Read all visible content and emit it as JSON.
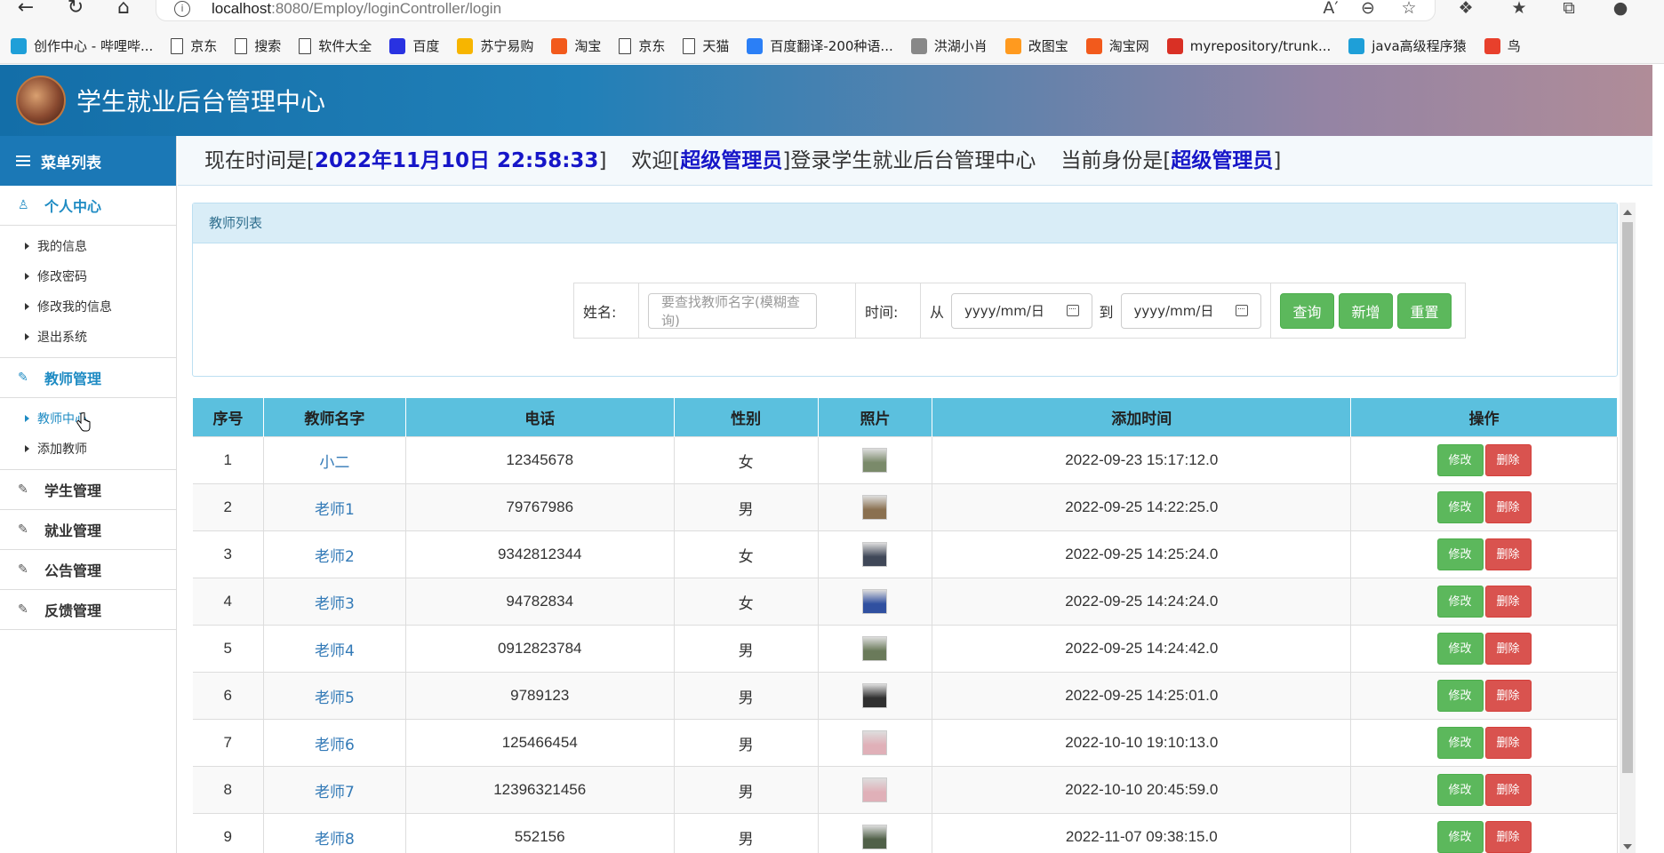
{
  "browser": {
    "url_host": "localhost",
    "url_rest": ":8080/Employ/loginController/login",
    "bookmarks": [
      {
        "label": "创作中心 - 哔哩哔...",
        "icon": "bilibili-icon",
        "color": "#1e9fd8"
      },
      {
        "label": "京东",
        "icon": "page-icon",
        "color": "#ffffff"
      },
      {
        "label": "搜索",
        "icon": "page-icon",
        "color": "#ffffff"
      },
      {
        "label": "软件大全",
        "icon": "page-icon",
        "color": "#ffffff"
      },
      {
        "label": "百度",
        "icon": "baidu-icon",
        "color": "#2932e1"
      },
      {
        "label": "苏宁易购",
        "icon": "suning-icon",
        "color": "#f7b500"
      },
      {
        "label": "淘宝",
        "icon": "taobao-icon",
        "color": "#f25a1c"
      },
      {
        "label": "京东",
        "icon": "page-icon",
        "color": "#ffffff"
      },
      {
        "label": "天猫",
        "icon": "page-icon",
        "color": "#ffffff"
      },
      {
        "label": "百度翻译-200种语...",
        "icon": "translate-icon",
        "color": "#2b7ff6"
      },
      {
        "label": "洪湖小肖",
        "icon": "bird-icon",
        "color": "#888888"
      },
      {
        "label": "改图宝",
        "icon": "gaitubao-icon",
        "color": "#ff9a1f"
      },
      {
        "label": "淘宝网",
        "icon": "taobao-icon",
        "color": "#f25a1c"
      },
      {
        "label": "myrepository/trunk...",
        "icon": "chrome-icon",
        "color": "#d93025"
      },
      {
        "label": "java高级程序猿",
        "icon": "bilibili-icon",
        "color": "#1e9fd8"
      },
      {
        "label": "鸟",
        "icon": "bird-icon",
        "color": "#e8402c"
      }
    ]
  },
  "app": {
    "title": "学生就业后台管理中心"
  },
  "sidebar": {
    "menu_title": "菜单列表",
    "sections": [
      {
        "label": "个人中心",
        "icon": "user-icon",
        "active": true,
        "items": [
          "我的信息",
          "修改密码",
          "修改我的信息",
          "退出系统"
        ]
      },
      {
        "label": "教师管理",
        "icon": "edit-icon",
        "active": true,
        "items": [
          "教师中心",
          "添加教师"
        ],
        "active_item": "教师中心"
      },
      {
        "label": "学生管理",
        "icon": "edit-icon",
        "active": false,
        "items": []
      },
      {
        "label": "就业管理",
        "icon": "edit-icon",
        "active": false,
        "items": []
      },
      {
        "label": "公告管理",
        "icon": "edit-icon",
        "active": false,
        "items": []
      },
      {
        "label": "反馈管理",
        "icon": "edit-icon",
        "active": false,
        "items": []
      }
    ]
  },
  "status": {
    "time_prefix": "现在时间是[",
    "time_value": "2022年11月10日 22:58:33",
    "time_suffix": "]",
    "welcome_prefix": "欢迎[",
    "welcome_user": "超级管理员",
    "welcome_suffix": "]登录学生就业后台管理中心",
    "role_prefix": "当前身份是[",
    "role_value": "超级管理员",
    "role_suffix": "]"
  },
  "panel": {
    "title": "教师列表",
    "name_label": "姓名:",
    "name_placeholder": "要查找教师名字(模糊查询)",
    "time_label": "时间:",
    "from_label": "从",
    "to_label": "到",
    "date_placeholder": "yyyy/mm/日",
    "buttons": {
      "query": "查询",
      "add": "新增",
      "reset": "重置"
    }
  },
  "table": {
    "headers": [
      "序号",
      "教师名字",
      "电话",
      "性别",
      "照片",
      "添加时间",
      "操作"
    ],
    "edit_label": "修改",
    "delete_label": "删除",
    "rows": [
      {
        "no": "1",
        "name": "小二",
        "phone": "12345678",
        "gender": "女",
        "time": "2022-09-23 15:17:12.0",
        "photo_color": "#7a8a6a"
      },
      {
        "no": "2",
        "name": "老师1",
        "phone": "79767986",
        "gender": "男",
        "time": "2022-09-25 14:22:25.0",
        "photo_color": "#8a7050"
      },
      {
        "no": "3",
        "name": "老师2",
        "phone": "9342812344",
        "gender": "女",
        "time": "2022-09-25 14:25:24.0",
        "photo_color": "#404858"
      },
      {
        "no": "4",
        "name": "老师3",
        "phone": "94782834",
        "gender": "女",
        "time": "2022-09-25 14:24:24.0",
        "photo_color": "#3050a0"
      },
      {
        "no": "5",
        "name": "老师4",
        "phone": "0912823784",
        "gender": "男",
        "time": "2022-09-25 14:24:42.0",
        "photo_color": "#6a7a5a"
      },
      {
        "no": "6",
        "name": "老师5",
        "phone": "9789123",
        "gender": "男",
        "time": "2022-09-25 14:25:01.0",
        "photo_color": "#303030"
      },
      {
        "no": "7",
        "name": "老师6",
        "phone": "125466454",
        "gender": "男",
        "time": "2022-10-10 19:10:13.0",
        "photo_color": "#e0b0b8"
      },
      {
        "no": "8",
        "name": "老师7",
        "phone": "12396321456",
        "gender": "男",
        "time": "2022-10-10 20:45:59.0",
        "photo_color": "#e0b0b8"
      },
      {
        "no": "9",
        "name": "老师8",
        "phone": "552156",
        "gender": "男",
        "time": "2022-11-07 09:38:15.0",
        "photo_color": "#506048"
      }
    ]
  }
}
